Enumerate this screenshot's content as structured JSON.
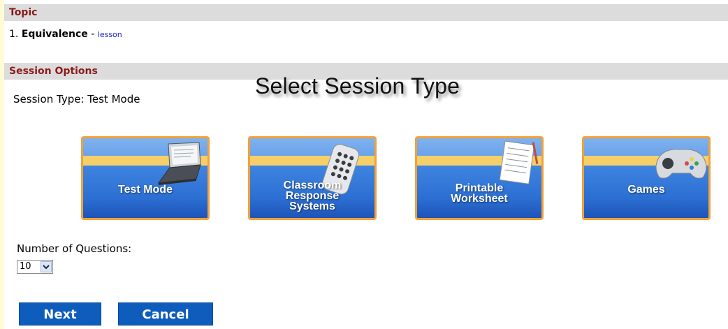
{
  "topic": {
    "header": "Topic",
    "number": "1.",
    "name": "Equivalence",
    "separator": "-",
    "link": "lesson"
  },
  "session_options": {
    "header": "Session Options",
    "session_type_text": "Session Type: Test Mode",
    "headline": "Select Session Type"
  },
  "modes": [
    {
      "label_lines": [
        "Test Mode"
      ],
      "icon": "laptop-icon"
    },
    {
      "label_lines": [
        "Classroom",
        "Response",
        "Systems"
      ],
      "icon": "clicker-remote-icon"
    },
    {
      "label_lines": [
        "Printable",
        "Worksheet"
      ],
      "icon": "worksheet-icon"
    },
    {
      "label_lines": [
        "Games"
      ],
      "icon": "gamepad-icon"
    }
  ],
  "questions": {
    "label": "Number of Questions:",
    "value": "10"
  },
  "actions": {
    "next": "Next",
    "cancel": "Cancel"
  },
  "colors": {
    "section_bar_bg": "#dcdcdc",
    "section_header_text": "#8b1a1a",
    "button_blue": "#0e5dbd",
    "tile_border": "#f2a13b",
    "link": "#1a1acc"
  }
}
